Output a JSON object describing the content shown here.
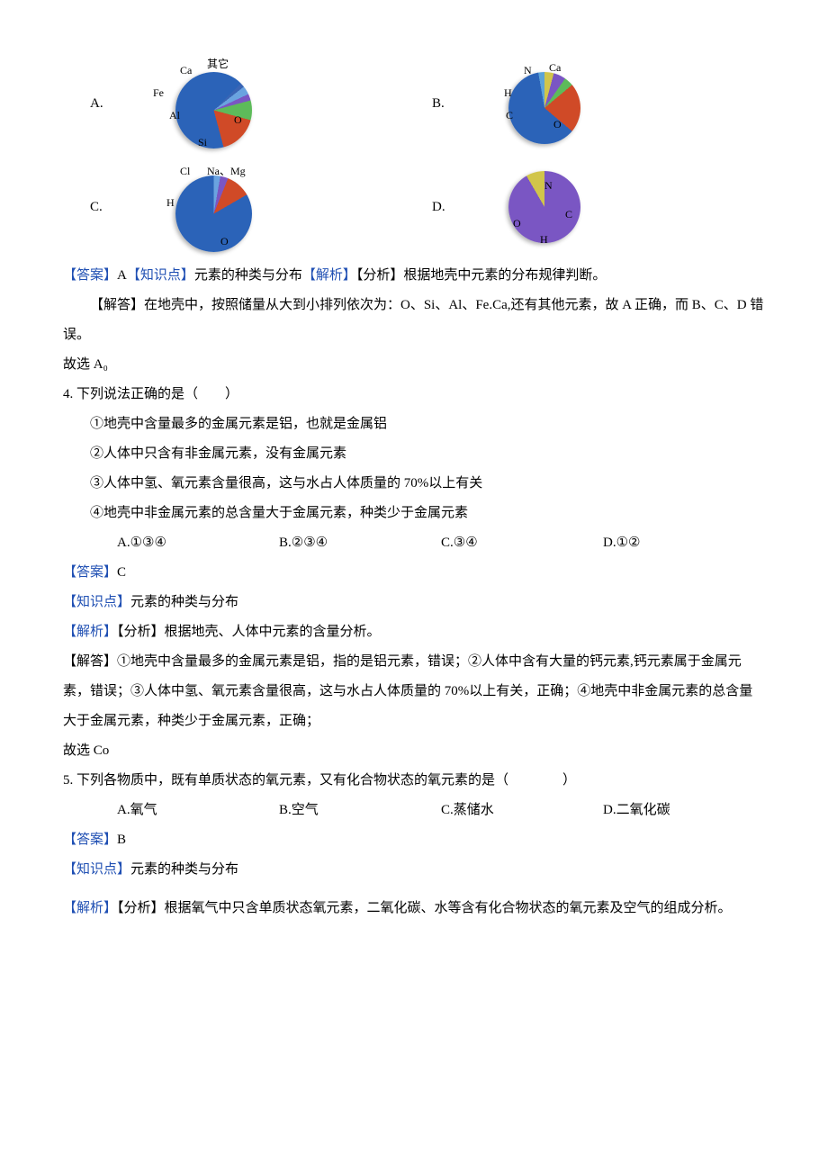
{
  "pieA": {
    "labels": {
      "other": "其它",
      "ca": "Ca",
      "fe": "Fe",
      "al": "Al",
      "si": "Si",
      "o": "O"
    }
  },
  "pieB": {
    "labels": {
      "n": "N",
      "ca": "Ca",
      "h": "H",
      "c": "C",
      "o": "O"
    }
  },
  "pieC": {
    "labels": {
      "cl": "Cl",
      "namg": "Na、Mg",
      "h": "H",
      "o": "O"
    }
  },
  "pieD": {
    "labels": {
      "n": "N",
      "c": "C",
      "h": "H",
      "o": "O"
    }
  },
  "optLetters": {
    "a": "A.",
    "b": "B.",
    "c": "C.",
    "d": "D."
  },
  "q3": {
    "answerLine": {
      "ansLabel": "【答案】",
      "ansVal": "A",
      "kpLabel": "【知识点】",
      "kpVal": "元素的种类与分布",
      "analysisLabel": "【解析】",
      "analysisVal": "【分析】根据地壳中元素的分布规律判断。"
    },
    "solve": "【解答】在地壳中，按照储量从大到小排列依次为：O、Si、Al、Fe.Ca,还有其他元素，故 A 正确，而 B、C、D 错误。",
    "therefore": "故选 A₀"
  },
  "q4": {
    "stem": "4.  下列说法正确的是（　　）",
    "s1": "①地壳中含量最多的金属元素是铝，也就是金属铝",
    "s2": "②人体中只含有非金属元素，没有金属元素",
    "s3": "③人体中氢、氧元素含量很高，这与水占人体质量的 70%以上有关",
    "s4": "④地壳中非金属元素的总含量大于金属元素，种类少于金属元素",
    "choiceA": "A.①③④",
    "choiceB": "B.②③④",
    "choiceC": "C.③④",
    "choiceD": "D.①②",
    "ansLabel": "【答案】",
    "ansVal": "C",
    "kpLabel": "【知识点】",
    "kpVal": "元素的种类与分布",
    "analysisLabel": "【解析】",
    "analysisVal": "【分析】根据地壳、人体中元素的含量分析。",
    "solve": "【解答】①地壳中含量最多的金属元素是铝，指的是铝元素，错误；②人体中含有大量的钙元素,钙元素属于金属元素，错误；③人体中氢、氧元素含量很高，这与水占人体质量的 70%以上有关，正确；④地壳中非金属元素的总含量大于金属元素，种类少于金属元素，正确；",
    "therefore": "故选 Co"
  },
  "q5": {
    "stem": "5.  下列各物质中，既有单质状态的氧元素，又有化合物状态的氧元素的是（　　　　）",
    "choiceA": "A.氧气",
    "choiceB": "B.空气",
    "choiceC": "C.蒸储水",
    "choiceD": "D.二氧化碳",
    "ansLabel": "【答案】",
    "ansVal": "B",
    "kpLabel": "【知识点】",
    "kpVal": "元素的种类与分布",
    "analysisLabel": "【解析】",
    "analysisVal": "【分析】根据氧气中只含单质状态氧元素，二氧化碳、水等含有化合物状态的氧元素及空气的组成分析。"
  }
}
